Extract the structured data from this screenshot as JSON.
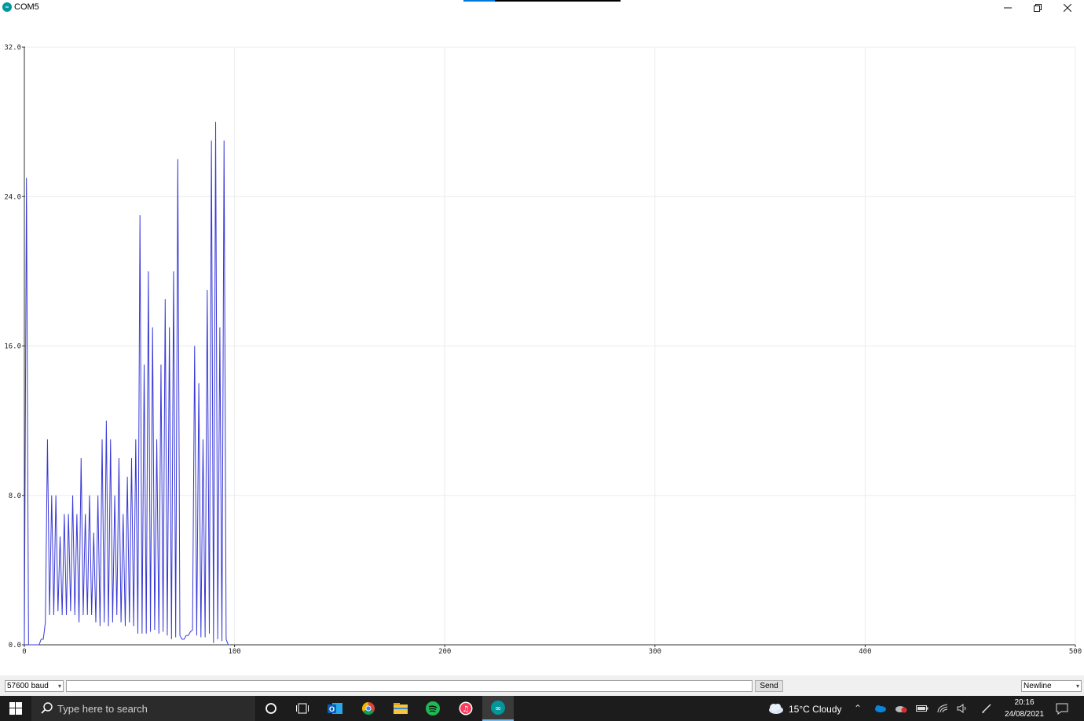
{
  "window": {
    "title": "COM5",
    "icon": "arduino-infinity-icon",
    "controls": {
      "minimize": "minimize-icon",
      "maximize": "restore-icon",
      "close": "close-icon"
    }
  },
  "chart_data": {
    "type": "line",
    "x_ticks": [
      "0",
      "100",
      "200",
      "300",
      "400",
      "500"
    ],
    "y_ticks": [
      "0.0",
      "8.0",
      "16.0",
      "24.0",
      "32.0"
    ],
    "xlim": [
      0,
      500
    ],
    "ylim": [
      0,
      32
    ],
    "grid": true,
    "series": [
      {
        "color": "#3838d8",
        "values": [
          0,
          25,
          0,
          0,
          0,
          0,
          0,
          0,
          0.3,
          0.3,
          1.2,
          11,
          1.6,
          8,
          1.6,
          8,
          1.8,
          5.8,
          1.6,
          7,
          1.6,
          7,
          1.8,
          8,
          1.6,
          7,
          1.2,
          10,
          1.6,
          7,
          1.6,
          8,
          1.6,
          6,
          1.2,
          8,
          1.0,
          11,
          1.2,
          12,
          1.0,
          11,
          1.2,
          8,
          1.6,
          10,
          1.2,
          7,
          1.0,
          9,
          1.2,
          10,
          1.0,
          11,
          0.6,
          23,
          0.6,
          15,
          0.6,
          20,
          0.7,
          17,
          0.8,
          11,
          0.6,
          15,
          0.7,
          18.5,
          0.5,
          17,
          0.3,
          20,
          0.4,
          26,
          0.5,
          0.3,
          0.3,
          0.5,
          0.5,
          0.7,
          0.8,
          16,
          0.5,
          14,
          0.4,
          11,
          0.4,
          19,
          0.6,
          27,
          0.1,
          28,
          0.3,
          17,
          0.2,
          27,
          0.3,
          0,
          0
        ]
      }
    ]
  },
  "bottom_bar": {
    "baud": "57600 baud",
    "input_value": "",
    "send_label": "Send",
    "line_ending": "Newline"
  },
  "taskbar": {
    "search_placeholder": "Type here to search",
    "apps": [
      "cortana-icon",
      "task-view-icon",
      "outlook-icon",
      "chrome-icon",
      "file-explorer-icon",
      "spotify-icon",
      "itunes-icon",
      "arduino-icon"
    ],
    "weather": "15°C  Cloudy",
    "time": "20:16",
    "date": "24/08/2021"
  }
}
